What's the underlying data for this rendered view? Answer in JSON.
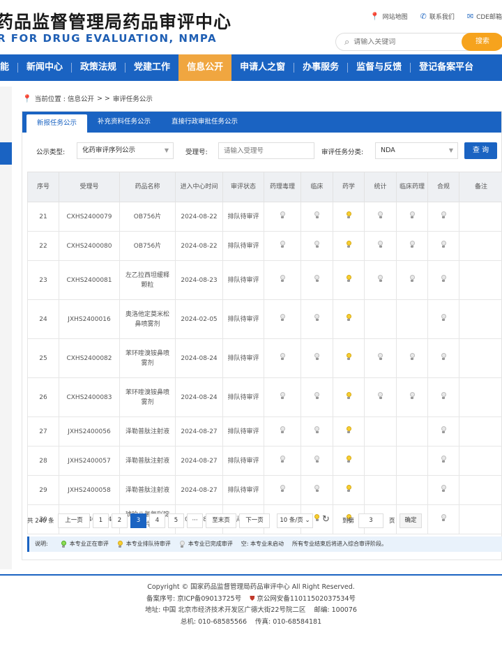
{
  "header": {
    "logo_cn": "药品监督管理局药品审评中心",
    "logo_en": "R FOR DRUG EVALUATION, NMPA",
    "links": [
      "网站地图",
      "联系我们",
      "CDE邮箱"
    ],
    "search_placeholder": "请输入关键词",
    "search_button": "搜索"
  },
  "nav": {
    "items": [
      "能",
      "新闻中心",
      "政策法规",
      "党建工作",
      "信息公开",
      "申请人之窗",
      "办事服务",
      "监督与反馈",
      "登记备案平台"
    ],
    "active_index": 4
  },
  "breadcrumb": {
    "prefix": "当前位置 : 信息公开",
    "sep": "> >",
    "current": "审评任务公示"
  },
  "tabs": [
    "新报任务公示",
    "补充资料任务公示",
    "直接行政审批任务公示"
  ],
  "filters": {
    "type_label": "公示类型:",
    "type_value": "化药审评序列公示",
    "accept_label": "受理号:",
    "accept_placeholder": "请输入受理号",
    "category_label": "审评任务分类:",
    "category_value": "NDA",
    "query_button": "查 询"
  },
  "table": {
    "headers": [
      "序号",
      "受理号",
      "药品名称",
      "进入中心时间",
      "审评状态",
      "药理毒理",
      "临床",
      "药学",
      "统计",
      "临床药理",
      "合规",
      "备注"
    ],
    "rows": [
      {
        "no": "21",
        "id": "CXHS2400079",
        "name": "OB756片",
        "date": "2024-08-22",
        "status": "排队待审评",
        "lights": [
          "done",
          "done",
          "queue",
          "done",
          "done",
          "done"
        ]
      },
      {
        "no": "22",
        "id": "CXHS2400080",
        "name": "OB756片",
        "date": "2024-08-22",
        "status": "排队待审评",
        "lights": [
          "done",
          "done",
          "queue",
          "done",
          "done",
          "done"
        ]
      },
      {
        "no": "23",
        "id": "CXHS2400081",
        "name": "左乙拉西坦缓释颗粒",
        "date": "2024-08-23",
        "status": "排队待审评",
        "lights": [
          "done",
          "done",
          "queue",
          "done",
          "done",
          "done"
        ]
      },
      {
        "no": "24",
        "id": "JXHS2400016",
        "name": "奥洛他定莫米松鼻喷雾剂",
        "date": "2024-02-05",
        "status": "排队待审评",
        "lights": [
          "done",
          "done",
          "queue",
          "",
          "",
          "done"
        ]
      },
      {
        "no": "25",
        "id": "CXHS2400082",
        "name": "苯环喹溴铵鼻喷雾剂",
        "date": "2024-08-24",
        "status": "排队待审评",
        "lights": [
          "done",
          "done",
          "queue",
          "done",
          "done",
          "done"
        ]
      },
      {
        "no": "26",
        "id": "CXHS2400083",
        "name": "苯环喹溴铵鼻喷雾剂",
        "date": "2024-08-24",
        "status": "排队待审评",
        "lights": [
          "done",
          "done",
          "queue",
          "done",
          "done",
          "done"
        ]
      },
      {
        "no": "27",
        "id": "JXHS2400056",
        "name": "泽勒普肽注射液",
        "date": "2024-08-27",
        "status": "排队待审评",
        "lights": [
          "done",
          "done",
          "queue",
          "",
          "",
          "done"
        ]
      },
      {
        "no": "28",
        "id": "JXHS2400057",
        "name": "泽勒普肽注射液",
        "date": "2024-08-27",
        "status": "排队待审评",
        "lights": [
          "done",
          "done",
          "queue",
          "",
          "",
          "done"
        ]
      },
      {
        "no": "29",
        "id": "JXHS2400058",
        "name": "泽勒普肽注射液",
        "date": "2024-08-27",
        "status": "排队待审评",
        "lights": [
          "done",
          "done",
          "queue",
          "",
          "",
          "done"
        ]
      },
      {
        "no": "30",
        "id": "CXHS2400084",
        "name": "琥珀八氢氨吖啶片",
        "date": "2024-08-29",
        "status": "排队待审评",
        "lights": [
          "done",
          "queue",
          "queue",
          "done",
          "done",
          "done"
        ]
      }
    ]
  },
  "pager": {
    "total": "共 240 条",
    "prev": "上一页",
    "pages": [
      "1",
      "2",
      "3",
      "4",
      "5",
      "···"
    ],
    "current": "3",
    "last": "至末页",
    "next": "下一页",
    "per_page": "10 条/页",
    "goto_label": "到第",
    "goto_value": "3",
    "page_unit": "页",
    "confirm": "确定"
  },
  "legend": {
    "title": "说明:",
    "active": "本专业正在审评",
    "queue": "本专业排队待审评",
    "done": "本专业已完成审评",
    "empty": "空: 本专业未启动",
    "note": "所有专业结束后将进入综合审评阶段。"
  },
  "footer": {
    "copyright": "Copyright © 国家药品监督管理局药品审评中心   All Right Reserved.",
    "icp": "备案序号: 京ICP备09013725号",
    "police": "京公网安备11011502037534号",
    "address": "地址: 中国 北京市经济技术开发区广德大街22号院二区",
    "postcode": "邮编: 100076",
    "phone": "总机: 010-68585566",
    "fax": "传真: 010-68584181"
  }
}
